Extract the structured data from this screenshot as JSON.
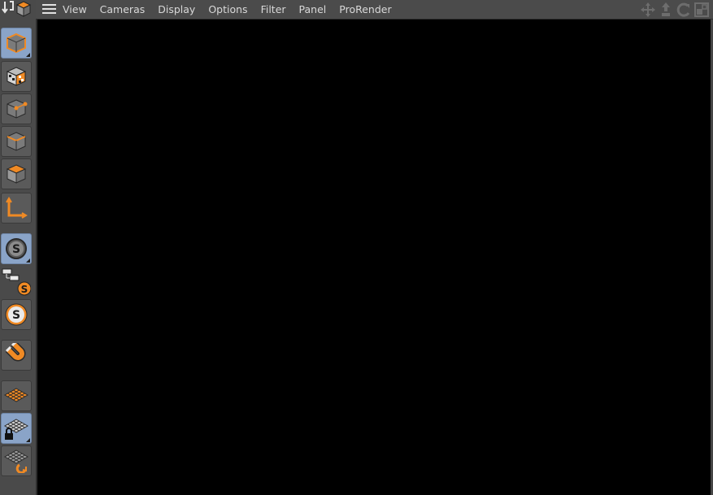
{
  "menubar": {
    "menus": [
      "View",
      "Cameras",
      "Display",
      "Options",
      "Filter",
      "Panel",
      "ProRender"
    ],
    "nav_icons": [
      "move-view-icon",
      "zoom-view-icon",
      "rotate-view-icon",
      "maximize-panel-icon"
    ]
  },
  "toolbar": {
    "buttons": [
      {
        "name": "model-mode-icon",
        "active": true
      },
      {
        "name": "texture-mode-icon",
        "active": false
      },
      {
        "name": "points-mode-icon",
        "active": false
      },
      {
        "name": "edges-mode-icon",
        "active": false
      },
      {
        "name": "polygons-mode-icon",
        "active": false
      },
      {
        "name": "axis-mode-icon",
        "active": false
      },
      {
        "name": "enable-snap-icon",
        "active": true
      },
      {
        "name": "hierarchy-snap-icon",
        "active": false
      },
      {
        "name": "snap-settings-icon",
        "active": false
      },
      {
        "name": "magnet-icon",
        "active": false
      },
      {
        "name": "workplane-icon",
        "active": false
      },
      {
        "name": "locked-workplane-icon",
        "active": true
      },
      {
        "name": "workplane-align-icon",
        "active": false
      }
    ]
  },
  "colors": {
    "accent": "#f08a24",
    "active_button": "#8aa4c8",
    "viewport": "#000000",
    "panel": "#4a4a4a"
  }
}
